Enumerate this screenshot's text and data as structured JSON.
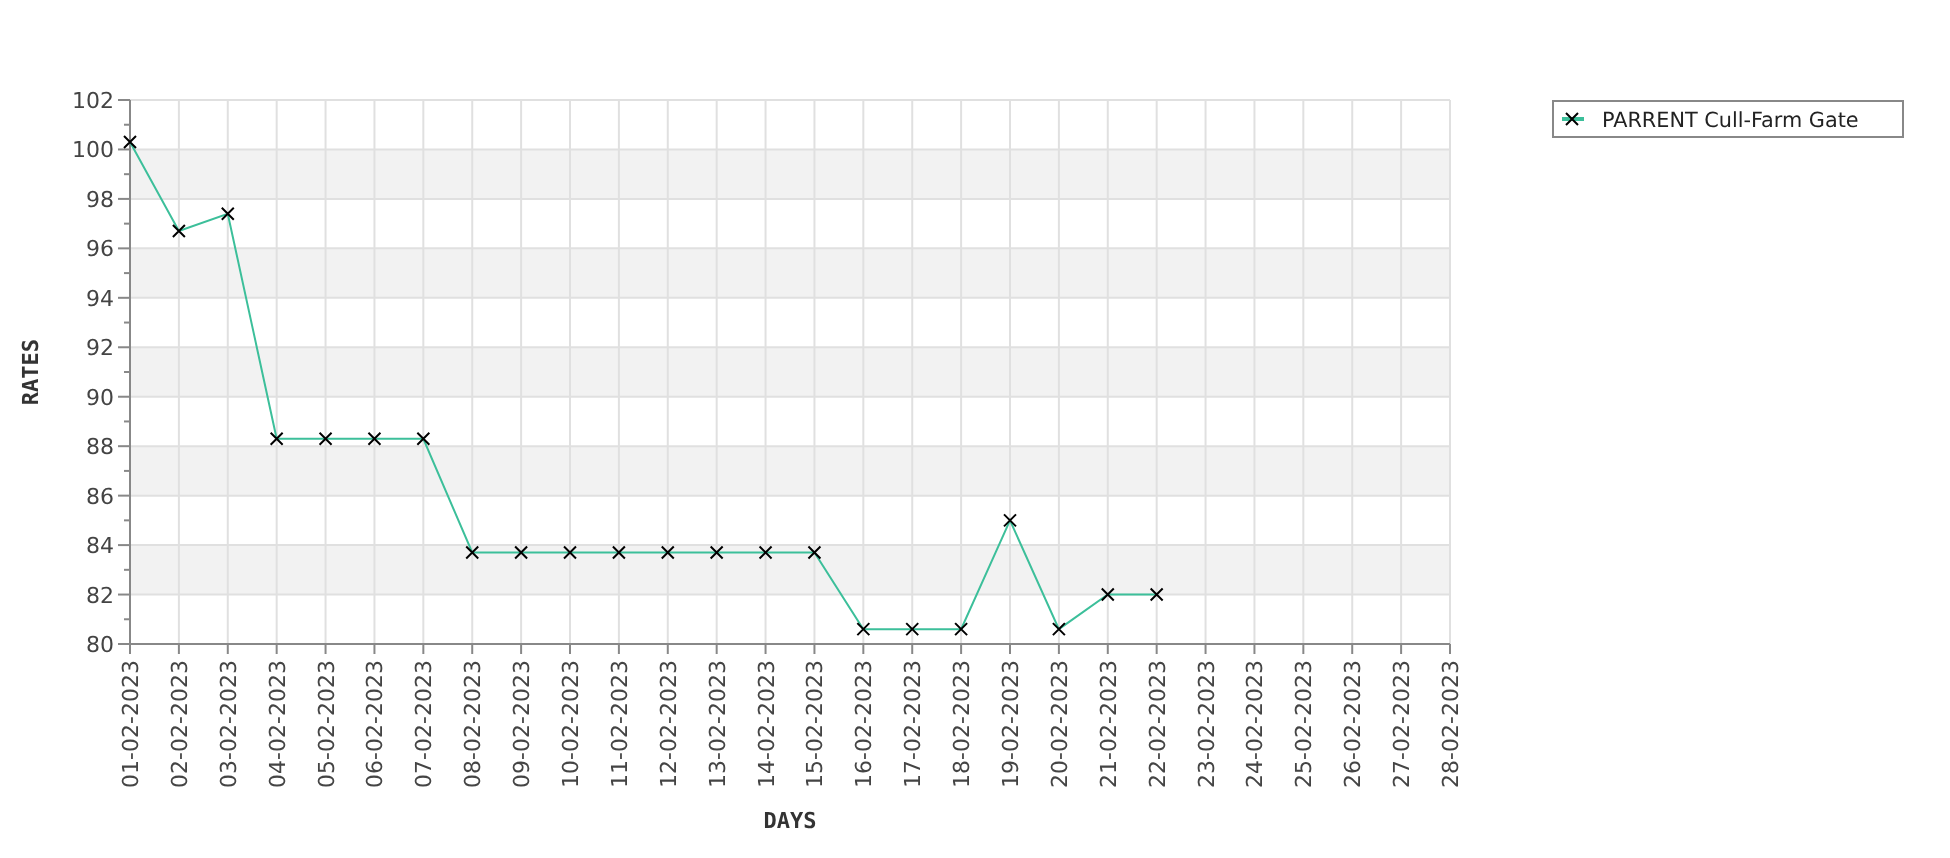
{
  "chart_data": {
    "type": "line",
    "grid": true,
    "xlabel": "DAYS",
    "ylabel": "RATES",
    "categories": [
      "01-02-2023",
      "02-02-2023",
      "03-02-2023",
      "04-02-2023",
      "05-02-2023",
      "06-02-2023",
      "07-02-2023",
      "08-02-2023",
      "09-02-2023",
      "10-02-2023",
      "11-02-2023",
      "12-02-2023",
      "13-02-2023",
      "14-02-2023",
      "15-02-2023",
      "16-02-2023",
      "17-02-2023",
      "18-02-2023",
      "19-02-2023",
      "20-02-2023",
      "21-02-2023",
      "22-02-2023",
      "23-02-2023",
      "24-02-2023",
      "25-02-2023",
      "26-02-2023",
      "27-02-2023",
      "28-02-2023"
    ],
    "series": [
      {
        "name": "PARRENT Cull-Farm Gate",
        "color": "#3cbf9a",
        "marker": "x",
        "values": [
          100.3,
          96.7,
          97.4,
          88.3,
          88.3,
          88.3,
          88.3,
          83.7,
          83.7,
          83.7,
          83.7,
          83.7,
          83.7,
          83.7,
          83.7,
          80.6,
          80.6,
          80.6,
          85,
          80.6,
          82,
          82,
          null,
          null,
          null,
          null,
          null,
          null
        ]
      }
    ],
    "ylim": [
      80,
      102
    ],
    "yticks": [
      80,
      82,
      84,
      86,
      88,
      90,
      92,
      94,
      96,
      98,
      100,
      102
    ]
  }
}
